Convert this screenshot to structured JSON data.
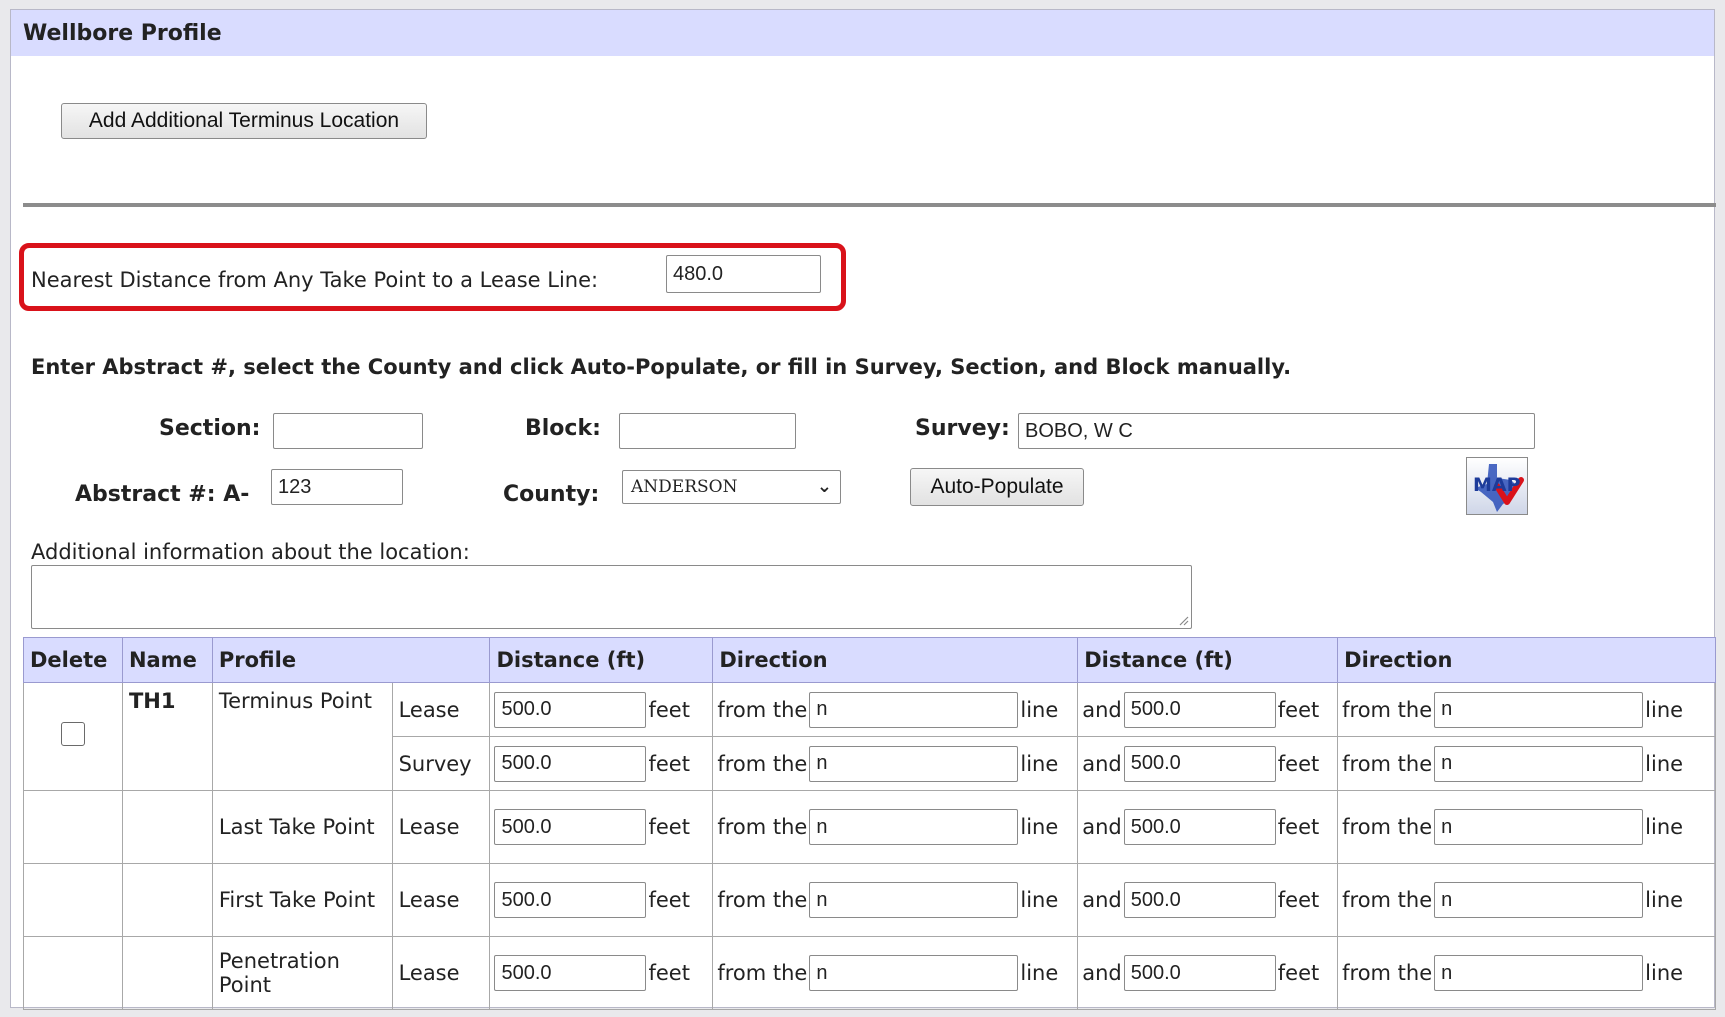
{
  "section_title": "Wellbore Profile",
  "add_terminus_button": "Add Additional Terminus Location",
  "nearest_distance": {
    "label": "Nearest Distance from Any Take Point to a Lease Line:",
    "value": "480.0",
    "highlight_color": "#d9121a"
  },
  "instructions": "Enter Abstract #, select the County and click Auto-Populate, or fill in Survey, Section, and Block manually.",
  "location": {
    "section_label": "Section:",
    "section_value": "",
    "block_label": "Block:",
    "block_value": "",
    "survey_label": "Survey:",
    "survey_value": "BOBO, W C",
    "abstract_label": "Abstract #: A-",
    "abstract_value": "123",
    "county_label": "County:",
    "county_value": "ANDERSON",
    "auto_populate_button": "Auto-Populate",
    "map_icon": "map-texas-icon",
    "map_text": "MAP"
  },
  "additional_info_label": "Additional information about the location:",
  "table": {
    "headers": [
      "Delete",
      "Name",
      "Profile",
      "Distance (ft)",
      "Direction",
      "Distance (ft)",
      "Direction"
    ],
    "words": {
      "feet": "feet",
      "from_the": "from the",
      "line": "line",
      "and": "and"
    },
    "rows": [
      {
        "name": "TH1",
        "profile": "Terminus Point",
        "type": "Lease",
        "dist1": "500.0",
        "dir1": "n",
        "dist2": "500.0",
        "dir2": "n"
      },
      {
        "name": "",
        "profile": "",
        "type": "Survey",
        "dist1": "500.0",
        "dir1": "n",
        "dist2": "500.0",
        "dir2": "n"
      },
      {
        "name": "",
        "profile": "Last Take Point",
        "type": "Lease",
        "dist1": "500.0",
        "dir1": "n",
        "dist2": "500.0",
        "dir2": "n"
      },
      {
        "name": "",
        "profile": "First Take Point",
        "type": "Lease",
        "dist1": "500.0",
        "dir1": "n",
        "dist2": "500.0",
        "dir2": "n"
      },
      {
        "name": "",
        "profile": "Penetration Point",
        "type": "Lease",
        "dist1": "500.0",
        "dir1": "n",
        "dist2": "500.0",
        "dir2": "n"
      }
    ]
  },
  "colors": {
    "header_bg": "#d9dcff",
    "highlight": "#d9121a"
  }
}
